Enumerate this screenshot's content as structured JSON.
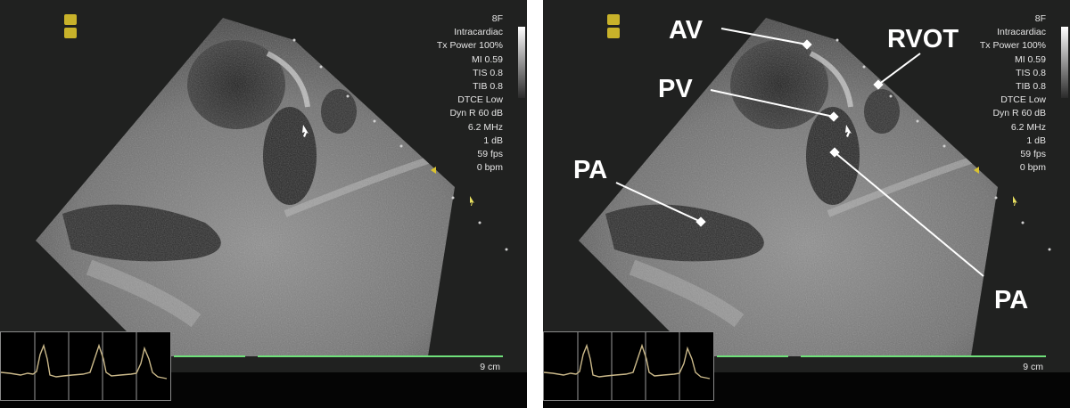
{
  "panels": [
    {
      "id": "left",
      "parameters": [
        "8F",
        "Intracardiac",
        "Tx Power 100%",
        "MI 0.59",
        "TIS 0.8",
        "TIB 0.8",
        "DTCE Low",
        "Dyn R 60 dB",
        "6.2 MHz",
        "1 dB",
        "59 fps",
        "0 bpm"
      ],
      "depth": "9 cm"
    },
    {
      "id": "right",
      "parameters": [
        "8F",
        "Intracardiac",
        "Tx Power 100%",
        "MI 0.59",
        "TIS 0.8",
        "TIB 0.8",
        "DTCE Low",
        "Dyn R 60 dB",
        "6.2 MHz",
        "1 dB",
        "59 fps",
        "0 bpm"
      ],
      "depth": "9 cm",
      "annotations": {
        "av": "AV",
        "rvot": "RVOT",
        "pv": "PV",
        "pa_left": "PA",
        "pa_right": "PA"
      }
    }
  ],
  "colors": {
    "background": "#202120",
    "depth_line": "#6fe07a",
    "logo": "#c8b22a",
    "ecg_trace": "#cbb98a",
    "label": "#ffffff"
  }
}
